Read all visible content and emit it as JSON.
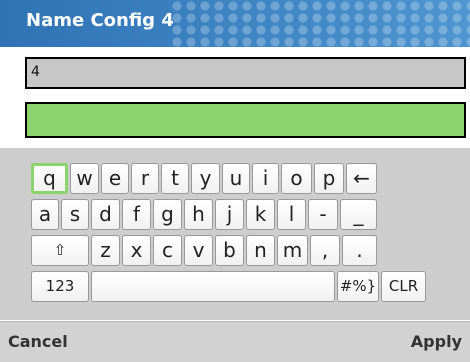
{
  "title": "Name Config 4",
  "field_value": "4",
  "keyboard": {
    "row1": [
      "q",
      "w",
      "e",
      "r",
      "t",
      "y",
      "u",
      "i",
      "o",
      "p",
      "←"
    ],
    "row2": [
      "a",
      "s",
      "d",
      "f",
      "g",
      "h",
      "j",
      "k",
      "l",
      "-",
      "_"
    ],
    "row3": [
      "⇧",
      "z",
      "x",
      "c",
      "v",
      "b",
      "n",
      "m",
      ",",
      "."
    ],
    "row4": [
      "123",
      "",
      "#%}",
      "CLR"
    ],
    "selected": "q"
  },
  "bottom": {
    "cancel": "Cancel",
    "apply": "Apply"
  },
  "colors": {
    "title_bar": "#3b80c0",
    "active_field": "#8bd46c",
    "selection": "#8bd46c"
  }
}
